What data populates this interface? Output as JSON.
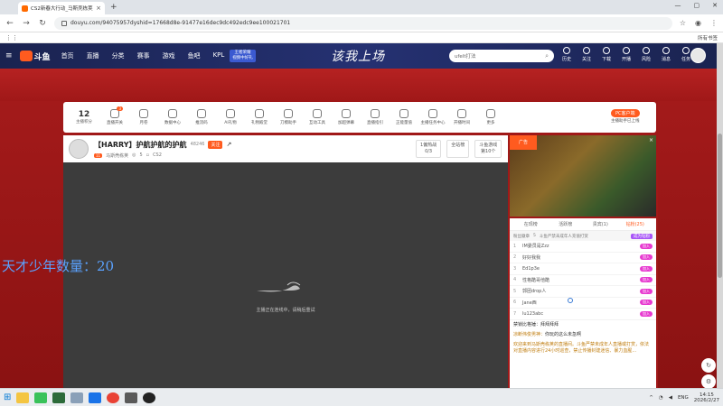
{
  "browser": {
    "tab_title": "CS2新春大行动_马斯壳栋荚直播",
    "tab_close": "×",
    "new_tab": "+",
    "url": "douyu.com/94075957dyshid=17668d8e-91477e16dec9dc492edc9ee100021701",
    "bookmarks_all": "所有书签",
    "window_controls": [
      "—",
      "▢",
      "✕"
    ]
  },
  "header": {
    "logo_text": "斗鱼",
    "nav": [
      "首页",
      "直播",
      "分类",
      "赛事",
      "游戏",
      "鱼吧",
      "KPL"
    ],
    "promo": [
      "王者荣耀",
      "视频中好礼"
    ],
    "slogan": "该我上场",
    "search_value": "ufelt打法",
    "icons": [
      "历史",
      "关注",
      "下载",
      "开播",
      "风险",
      "消息",
      "任务"
    ]
  },
  "toolbar": {
    "level_value": "12",
    "level_label": "主播积分",
    "items": [
      {
        "label": "直播开关",
        "badge": "3"
      },
      {
        "label": "月卷"
      },
      {
        "label": "数据中心"
      },
      {
        "label": "推流码"
      },
      {
        "label": "AI礼物"
      },
      {
        "label": "礼物殿堂"
      },
      {
        "label": "刀模助手"
      },
      {
        "label": "互动工具"
      },
      {
        "label": "加超弹幕"
      },
      {
        "label": "直播指引"
      },
      {
        "label": "正能量值"
      },
      {
        "label": "主播任务中心"
      },
      {
        "label": "开播时间"
      },
      {
        "label": "更多"
      }
    ],
    "pc_client_btn": "PC客户端",
    "pc_client_label": "主播助手已上线"
  },
  "room": {
    "title": "【HARRY】护航护航的护航",
    "room_id": "48246",
    "follow_label": "关注",
    "streamer_level": "11",
    "streamer_name": "马斯壳栋荚",
    "fans": "5",
    "category": "CS2",
    "rank_label": "1偏热战",
    "rank_value": "0/3",
    "whole_site": "全站榜",
    "card_label": "斗鱼游戏",
    "card_value": "第10个"
  },
  "video": {
    "message": "主播正在连线中，请稍后重试"
  },
  "overlay": {
    "text": "天才少年数量：20"
  },
  "thumb": {
    "ad_label": "广告",
    "close_label": "×"
  },
  "chat": {
    "tabs": [
      "在现榜",
      "活跃榜",
      "贵宾(1)",
      "钻粉(25)"
    ],
    "header_left": "粉丝徽章",
    "header_count": "5",
    "header_mid": "斗鱼严禁未成年人充值打赏",
    "header_btn": "成为钻粉",
    "ranks": [
      {
        "n": "1",
        "name": "IM委员是Zzz",
        "tag": "加入"
      },
      {
        "n": "2",
        "name": "好好我我",
        "tag": "加入"
      },
      {
        "n": "3",
        "name": "Ed1p3e",
        "tag": "加入"
      },
      {
        "n": "4",
        "name": "性格酷哥他酷",
        "tag": "加入"
      },
      {
        "n": "5",
        "name": "郭团drop人",
        "tag": "加入"
      },
      {
        "n": "6",
        "name": "Jane西",
        "tag": "加入"
      },
      {
        "n": "7",
        "name": "lu123abc",
        "tag": "加入"
      }
    ],
    "msg1": "禁锁比格锤：拜拜拜拜",
    "msg2_user": "凉断伟俊男神：",
    "msg2_text": "你玩的这么未急啊",
    "msg3": "欢迎来到马斯壳栋荚的直播间。斗鱼严禁未成年人直播或打赏，依法对直播内容进行24小时巡查，禁止传播封建迷信、暴力血腥..."
  },
  "taskbar": {
    "start": "⊞",
    "lang": "ENG",
    "time": "14:15",
    "date": "2026/2/27"
  }
}
